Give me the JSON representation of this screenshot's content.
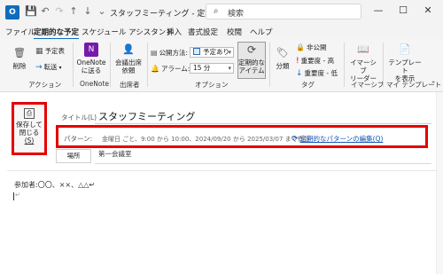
{
  "window": {
    "app_logo": "O",
    "title": "スタッフミーティング - 定期的...",
    "search_placeholder": "検索",
    "controls": {
      "min": "—",
      "max": "☐",
      "close": "✕"
    },
    "quick_access": {
      "save": "💾",
      "undo": "↶",
      "redo": "↷",
      "up": "↑",
      "down": "↓",
      "more": "⌄"
    }
  },
  "tabs": [
    "ファイル",
    "定期的な予定",
    "スケジュール アシスタント",
    "挿入",
    "書式設定",
    "校閲",
    "ヘルプ"
  ],
  "ribbon": {
    "actions": {
      "delete": "削除",
      "calendar": "予定表",
      "forward": "転送",
      "label": "アクション"
    },
    "onenote": {
      "button_line1": "OneNote",
      "button_line2": "に送る",
      "label": "OneNote"
    },
    "attendees": {
      "button_line1": "会議出席",
      "button_line2": "依頼",
      "label": "出席者"
    },
    "options": {
      "show_as_label": "公開方法:",
      "show_as_value": "予定あり",
      "reminder_label": "アラーム:",
      "reminder_value": "15 分",
      "recurrence_line1": "定期的な",
      "recurrence_line2": "アイテム",
      "label": "オプション"
    },
    "tags": {
      "category": "分類",
      "private": "非公開",
      "high": "重要度 - 高",
      "low": "重要度 - 低",
      "label": "タグ"
    },
    "immersive": {
      "button_line1": "イマーシブ",
      "button_line2": "リーダー",
      "label": "イマーシブ"
    },
    "templates": {
      "button_line1": "テンプレート",
      "button_line2": "を表示",
      "label": "マイ テンプレート"
    }
  },
  "form": {
    "save_close_line1": "保存して",
    "save_close_line2": "閉じる",
    "save_close_line3": "(S)",
    "title_label": "タイトル(L)",
    "subject": "スタッフミーティング",
    "pattern_label": "パターン:",
    "pattern_text": "金曜日 ごと、9:00 から 10:00、2024/09/20 から 2025/03/07 まで有効",
    "edit_recurrence": "定期的なパターンの編集(Q)",
    "location_button": "場所",
    "location_value": "第一会議室",
    "body_text": "参加者:〇〇、××、△△↵"
  },
  "colors": {
    "accent": "#0f6cbd",
    "highlight_border": "#e60000",
    "link": "#1a56b4"
  }
}
